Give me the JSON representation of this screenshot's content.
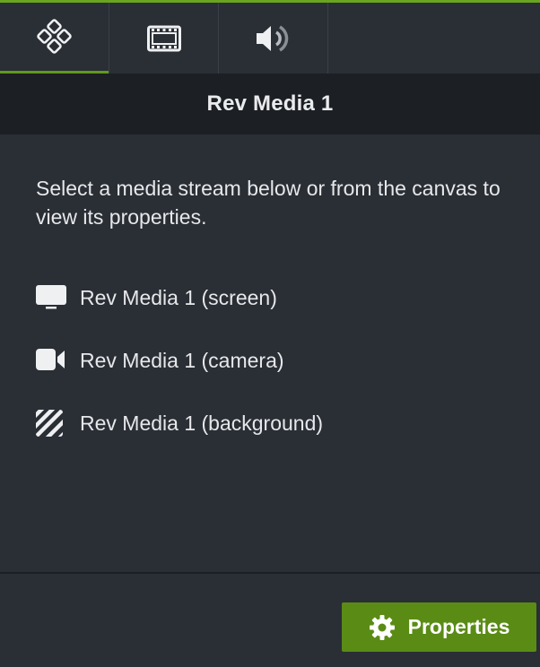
{
  "tabs": [
    {
      "icon": "diamond-grid-icon",
      "active": true
    },
    {
      "icon": "film-strip-icon",
      "active": false
    },
    {
      "icon": "speaker-icon",
      "active": false
    }
  ],
  "header": {
    "title": "Rev Media 1"
  },
  "panel": {
    "instructions": "Select a media stream below or from the canvas to view its properties.",
    "streams": [
      {
        "icon": "screen-icon",
        "label": "Rev Media 1 (screen)"
      },
      {
        "icon": "camera-icon",
        "label": "Rev Media 1 (camera)"
      },
      {
        "icon": "background-icon",
        "label": "Rev Media 1 (background)"
      }
    ]
  },
  "footer": {
    "button_label": "Properties",
    "button_icon": "gear-icon"
  },
  "colors": {
    "accent": "#6aa51f",
    "button": "#5a8c15",
    "panel_bg": "#2a2e35",
    "header_bg": "#1c1f23"
  }
}
